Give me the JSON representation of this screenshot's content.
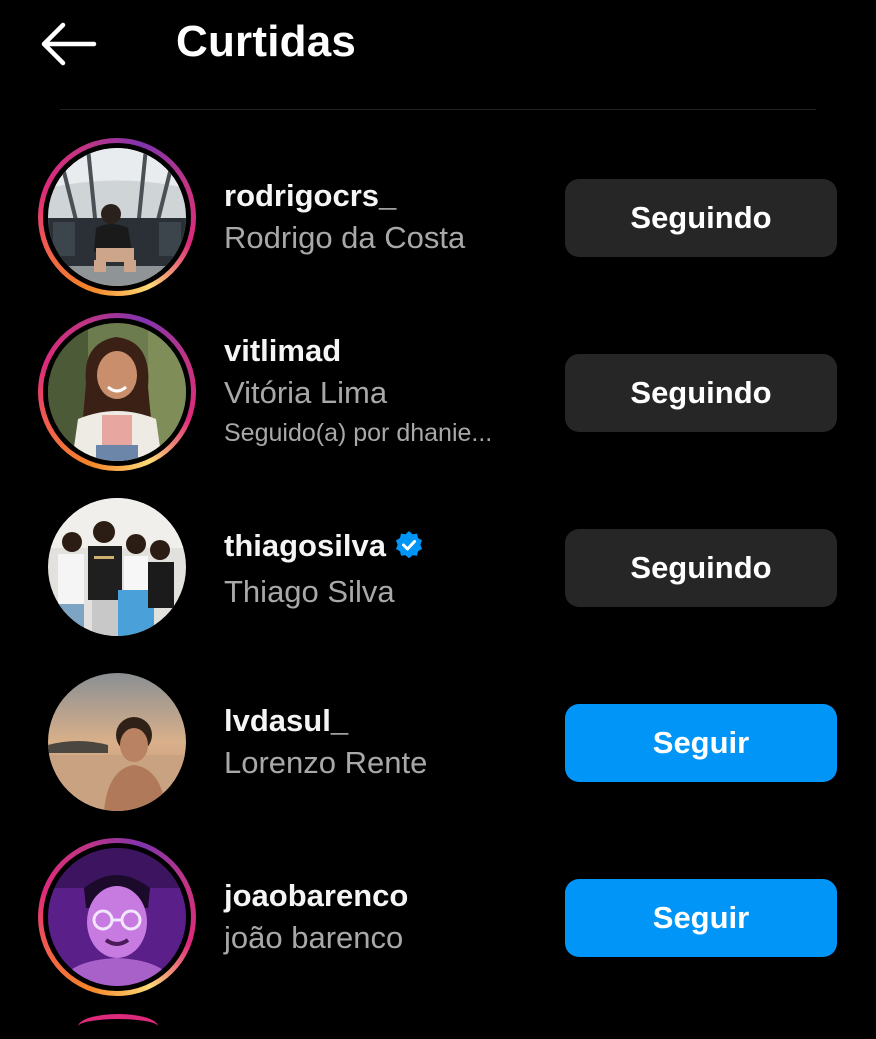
{
  "header": {
    "back_icon": "arrow-left-icon",
    "title": "Curtidas"
  },
  "colors": {
    "background": "#000000",
    "following_button": "#262626",
    "follow_button": "#0095f6",
    "secondary_text": "#a8a8a8",
    "verified_badge": "#0095f6"
  },
  "likes": [
    {
      "username": "rodrigocrs_",
      "full_name": "Rodrigo da Costa",
      "has_story": true,
      "verified": false,
      "button_label": "Seguindo",
      "button_state": "following"
    },
    {
      "username": "vitlimad",
      "full_name": "Vitória Lima",
      "mutual": "Seguido(a) por dhanie...",
      "has_story": true,
      "verified": false,
      "button_label": "Seguindo",
      "button_state": "following"
    },
    {
      "username": "thiagosilva",
      "full_name": "Thiago Silva",
      "has_story": false,
      "verified": true,
      "verified_icon": "verified-badge-icon",
      "button_label": "Seguindo",
      "button_state": "following"
    },
    {
      "username": "lvdasul_",
      "full_name": "Lorenzo Rente",
      "has_story": false,
      "verified": false,
      "button_label": "Seguir",
      "button_state": "follow"
    },
    {
      "username": "joaobarenco",
      "full_name": "joão barenco",
      "has_story": true,
      "verified": false,
      "button_label": "Seguir",
      "button_state": "follow"
    }
  ]
}
